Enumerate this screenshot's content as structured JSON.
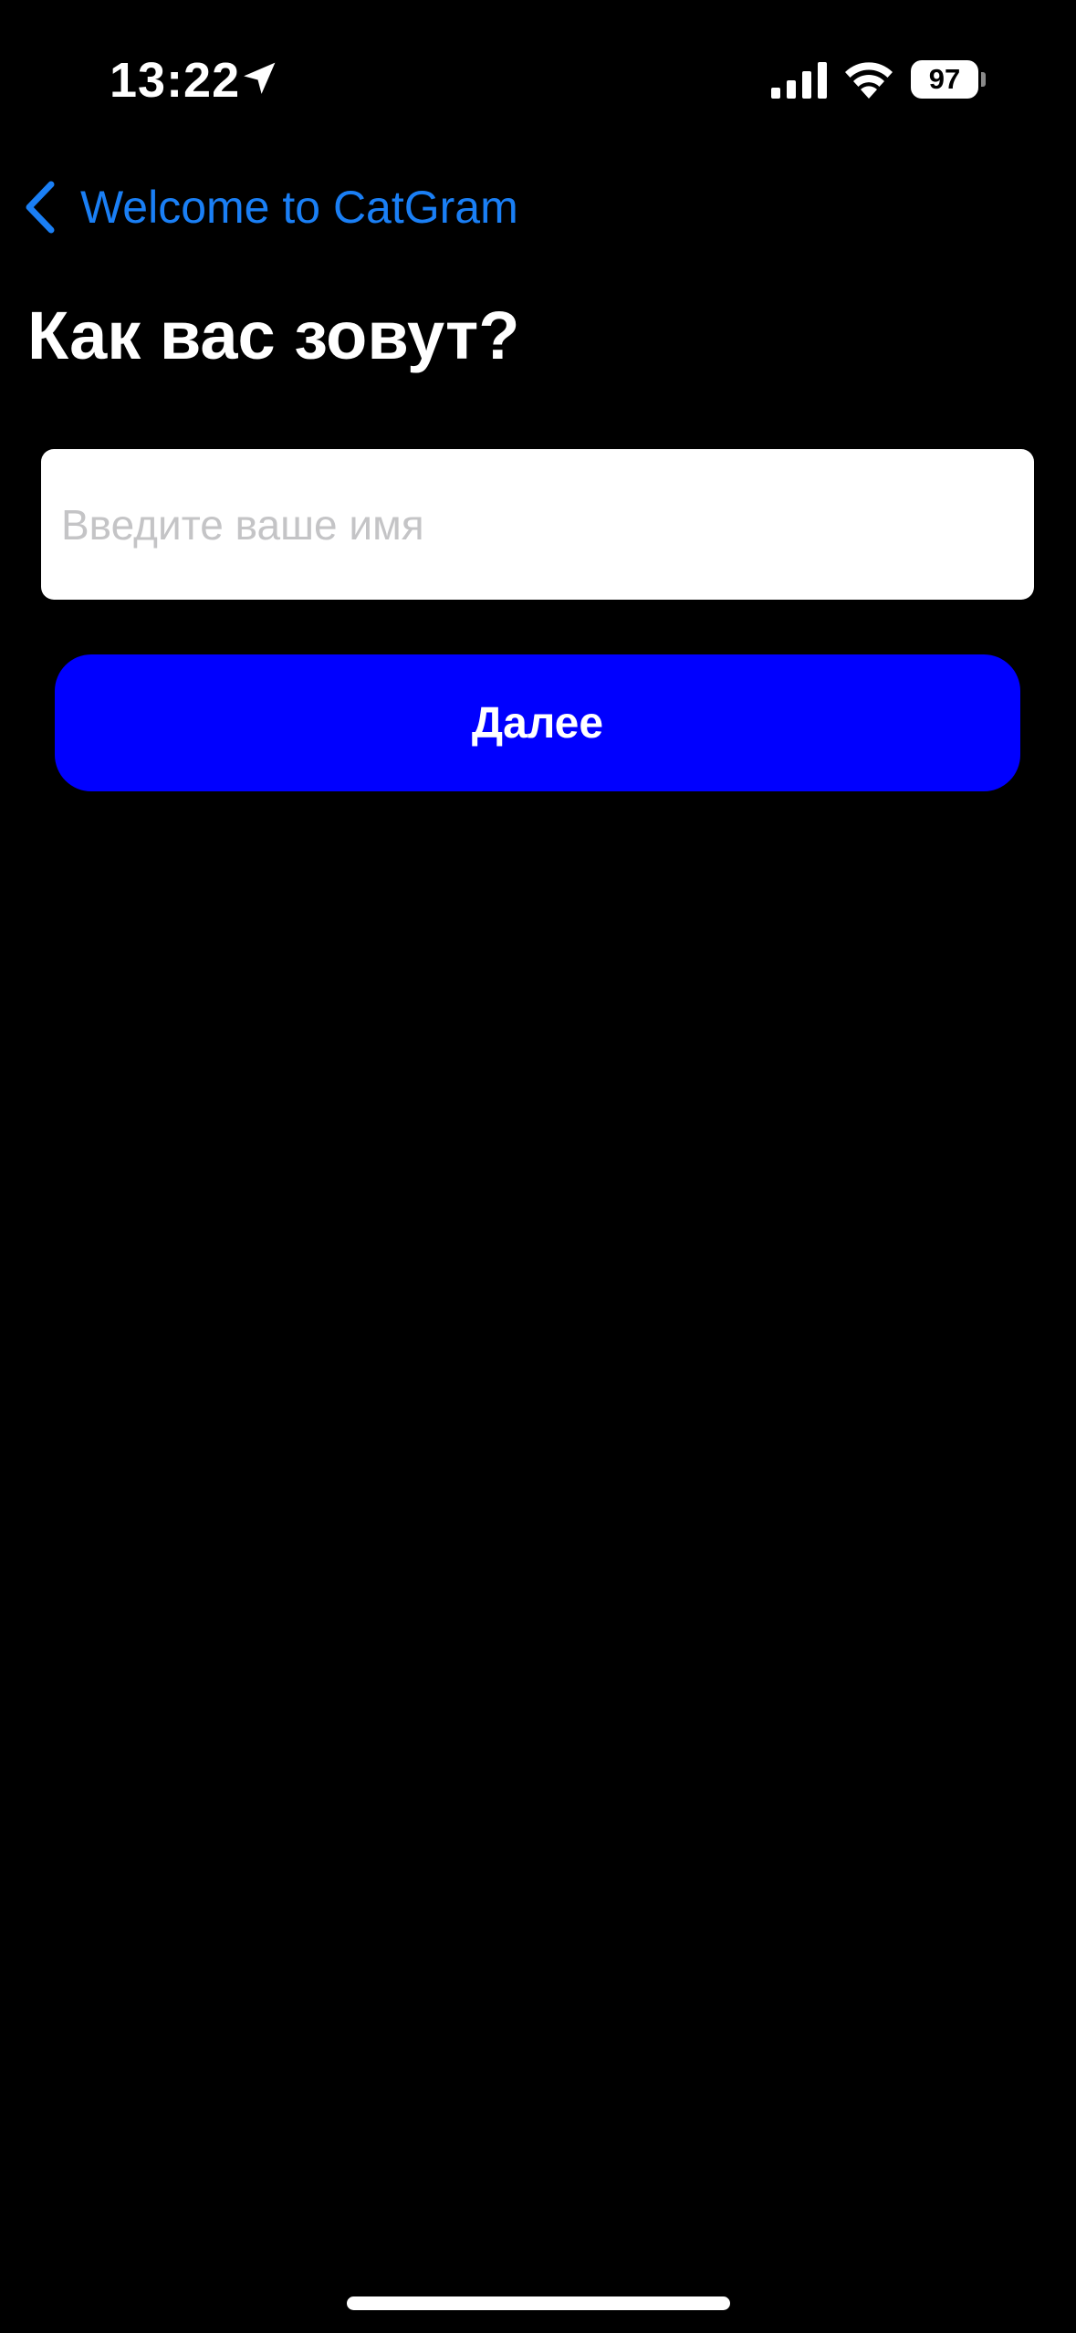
{
  "status_bar": {
    "time": "13:22",
    "battery_level": "97",
    "icons": [
      "location-arrow-icon",
      "cellular-signal-icon",
      "wifi-icon",
      "battery-icon"
    ]
  },
  "nav": {
    "back_label": "Welcome to CatGram",
    "back_icon": "chevron-left-icon",
    "accent_color": "#1a7ff5"
  },
  "page": {
    "title": "Как вас зовут?"
  },
  "name_field": {
    "value": "",
    "placeholder": "Введите ваше имя"
  },
  "next_button": {
    "label": "Далее",
    "color": "#0000ff"
  },
  "colors": {
    "background": "#000000",
    "text": "#ffffff"
  }
}
